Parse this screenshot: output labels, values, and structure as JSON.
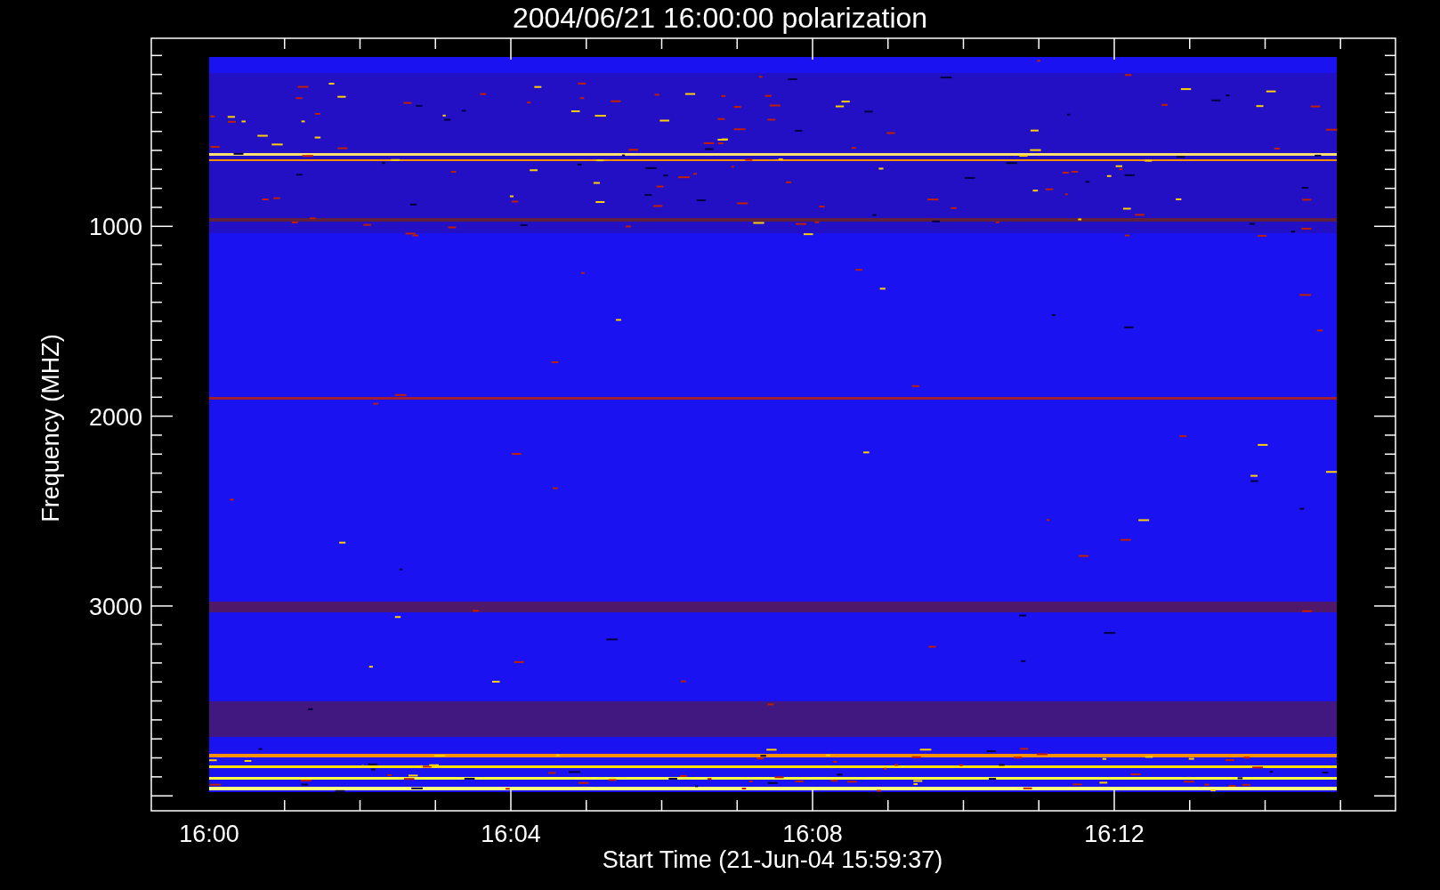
{
  "title": "2004/06/21 16:00:00 polarization",
  "y_axis": {
    "label": "Frequency (MHZ)",
    "ticks": [
      "1000",
      "2000",
      "3000"
    ]
  },
  "x_axis": {
    "label": "Start Time (21-Jun-04 15:59:37)",
    "ticks": [
      "16:00",
      "16:04",
      "16:08",
      "16:12"
    ]
  }
}
